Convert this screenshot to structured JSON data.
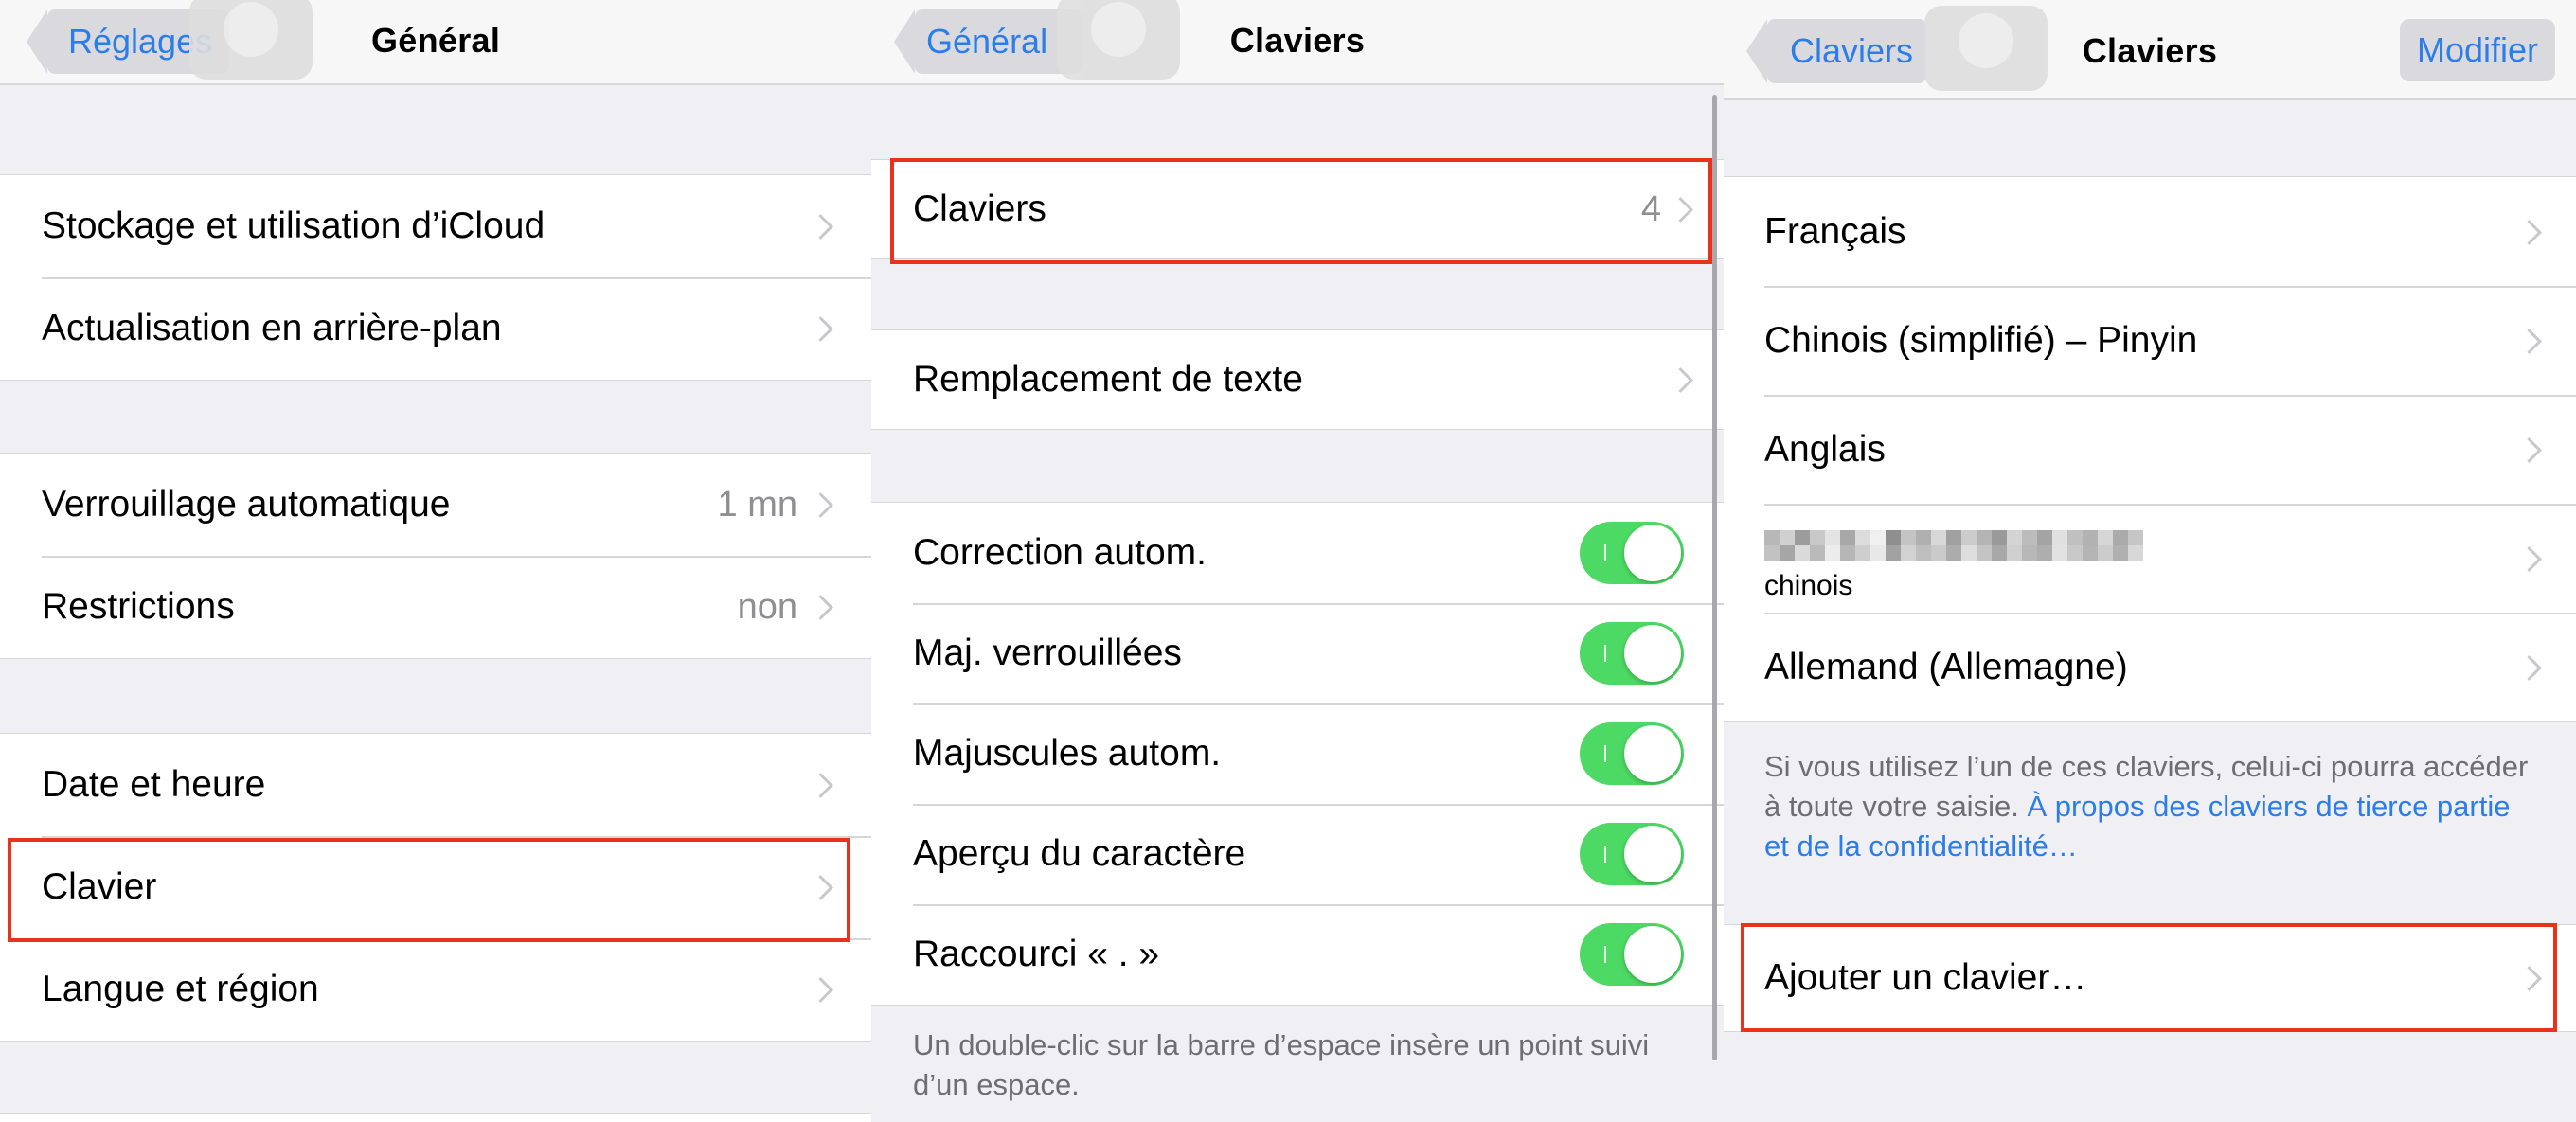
{
  "panel1": {
    "back_label": "Réglages",
    "title": "Général",
    "groups": [
      [
        {
          "label": "Stockage et utilisation d’iCloud",
          "value": ""
        },
        {
          "label": "Actualisation en arrière-plan",
          "value": ""
        }
      ],
      [
        {
          "label": "Verrouillage automatique",
          "value": "1 mn"
        },
        {
          "label": "Restrictions",
          "value": "non"
        }
      ],
      [
        {
          "label": "Date et heure",
          "value": ""
        },
        {
          "label": "Clavier",
          "value": ""
        },
        {
          "label": "Langue et région",
          "value": ""
        }
      ]
    ]
  },
  "panel2": {
    "back_label": "Général",
    "title": "Claviers",
    "keyboards": {
      "label": "Claviers",
      "value": "4"
    },
    "text_replacement": {
      "label": "Remplacement de texte"
    },
    "toggles": [
      {
        "label": "Correction autom.",
        "on": true
      },
      {
        "label": "Maj. verrouillées",
        "on": true
      },
      {
        "label": "Majuscules autom.",
        "on": true
      },
      {
        "label": "Aperçu du caractère",
        "on": true
      },
      {
        "label": "Raccourci « . »",
        "on": true
      }
    ],
    "footnote": "Un double-clic sur la barre d’espace insère un point suivi d’un espace."
  },
  "panel3": {
    "back_label": "Claviers",
    "title": "Claviers",
    "edit_label": "Modifier",
    "keyboards": [
      {
        "label": "Français"
      },
      {
        "label": "Chinois (simplifié) – Pinyin"
      },
      {
        "label": "Anglais"
      },
      {
        "label": "",
        "sublabel": "chinois"
      },
      {
        "label": "Allemand (Allemagne)"
      }
    ],
    "footnote_text": "Si vous utilisez l’un de ces claviers, celui-ci pourra accéder à toute votre saisie. ",
    "footnote_link": "À propos des claviers de tierce partie et de la confidentialité…",
    "add_keyboard": "Ajouter un clavier…"
  },
  "colors": {
    "accent": "#2b7de9",
    "toggle_on": "#4cd964",
    "highlight": "#e8321c",
    "background": "#efeff4"
  }
}
